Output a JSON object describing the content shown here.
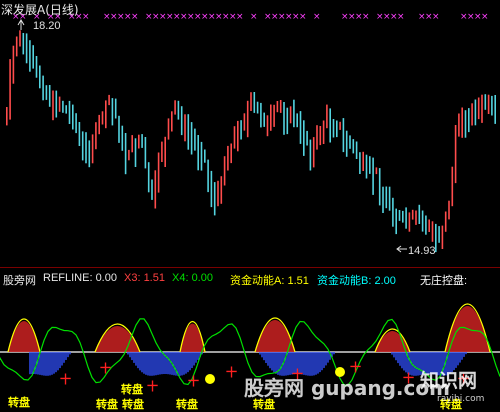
{
  "title": "深发展A(日线)",
  "price_high_label": "18.20",
  "price_low_label": "14.93",
  "indicator_bar": {
    "name": "股旁网",
    "refline": "REFLINE: 0.00",
    "x3": "X3: 1.51",
    "x4": "X4: 0.00",
    "fund_a": "资金动能A: 1.51",
    "fund_b": "资金动能B: 2.00",
    "no_dealer": "无庄控盘:"
  },
  "signal_labels": [
    "转盘",
    "转盘",
    "转盘",
    "转盘",
    "转盘",
    "转盘",
    "转盘"
  ],
  "watermark": {
    "text": "股旁网 gupang.com",
    "logo_text": "知识网",
    "logo_url": "rayibi.com"
  },
  "colors": {
    "up": "#ff4c4c",
    "down": "#54d4e0",
    "marker": "#ff40ff",
    "yellow": "#ffff00",
    "green": "#00e000",
    "blue": "#2040ff"
  }
}
